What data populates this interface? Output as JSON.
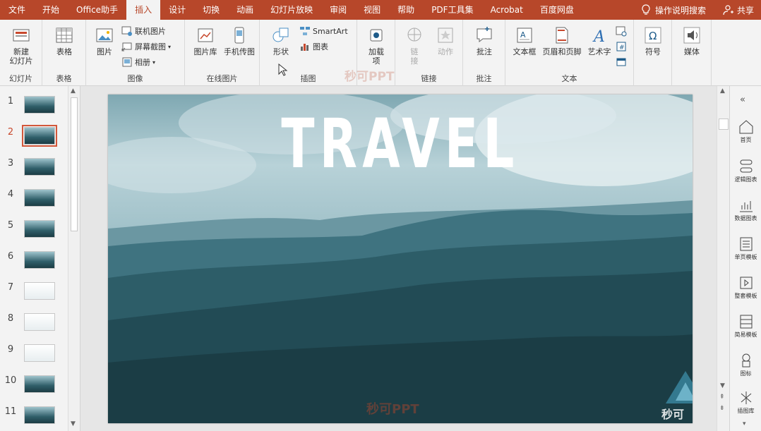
{
  "menu": {
    "tabs": [
      "文件",
      "开始",
      "Office助手",
      "插入",
      "设计",
      "切换",
      "动画",
      "幻灯片放映",
      "审阅",
      "视图",
      "帮助",
      "PDF工具集",
      "Acrobat",
      "百度网盘"
    ],
    "active_tab": "插入",
    "tell_me": "操作说明搜索",
    "share": "共享"
  },
  "ribbon": {
    "new_slide": "新建\n幻灯片",
    "group_slides": "幻灯片",
    "table": "表格",
    "group_table": "表格",
    "picture": "图片",
    "online_picture": "联机图片",
    "screenshot": "屏幕截图",
    "album": "相册",
    "group_images": "图像",
    "picture_library": "图片库",
    "phone_picture": "手机传图",
    "group_online_pictures": "在线图片",
    "shapes": "形状",
    "smartart": "SmartArt",
    "chart": "图表",
    "group_illustrations": "插图",
    "addins": "加载\n项",
    "link": "链\n接",
    "action": "动作",
    "group_links": "链接",
    "comment": "批注",
    "group_comments": "批注",
    "textbox": "文本框",
    "header_footer": "页眉和页脚",
    "wordart": "艺术字",
    "group_text": "文本",
    "symbol": "符号",
    "media": "媒体",
    "watermark": "秒可PPT"
  },
  "thumbnails": {
    "numbers": [
      "1",
      "2",
      "3",
      "4",
      "5",
      "6",
      "7",
      "8",
      "9",
      "10",
      "11"
    ],
    "selected": "2"
  },
  "slide": {
    "title": "TRAVEL",
    "watermark": "秒可PPT",
    "brand_watermark": "秒可职场"
  },
  "sidebar": {
    "items": [
      "首页",
      "逻辑图表",
      "数据图表",
      "单页模板",
      "整套模板",
      "简易模板",
      "图标",
      "插图库"
    ]
  },
  "colors": {
    "accent": "#b7472a",
    "slide_teal": "#2a5560"
  }
}
